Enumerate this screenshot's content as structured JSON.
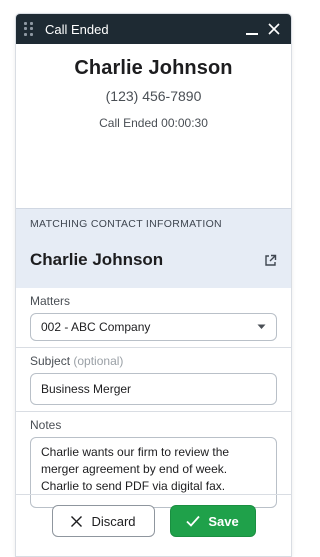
{
  "titlebar": {
    "title": "Call Ended",
    "icons": {
      "drag": "drag-handle-icon",
      "minimize": "minimize-icon",
      "close": "close-icon"
    }
  },
  "call": {
    "name": "Charlie Johnson",
    "phone": "(123) 456-7890",
    "status": "Call Ended 00:00:30"
  },
  "contact": {
    "section_label": "MATCHING CONTACT INFORMATION",
    "name": "Charlie Johnson",
    "open_icon": "external-link-icon"
  },
  "matters": {
    "label": "Matters",
    "selected": "002 - ABC Company"
  },
  "subject": {
    "label": "Subject",
    "optional": "(optional)",
    "value": "Business Merger"
  },
  "notes": {
    "label": "Notes",
    "value": "Charlie wants our firm to review the merger agreement by end of week. Charlie to send PDF via digital fax."
  },
  "actions": {
    "discard_label": "Discard",
    "save_label": "Save"
  },
  "colors": {
    "titlebar": "#1e2a33",
    "panel_header": "#e6ecf5",
    "save_button": "#1fa14a"
  }
}
